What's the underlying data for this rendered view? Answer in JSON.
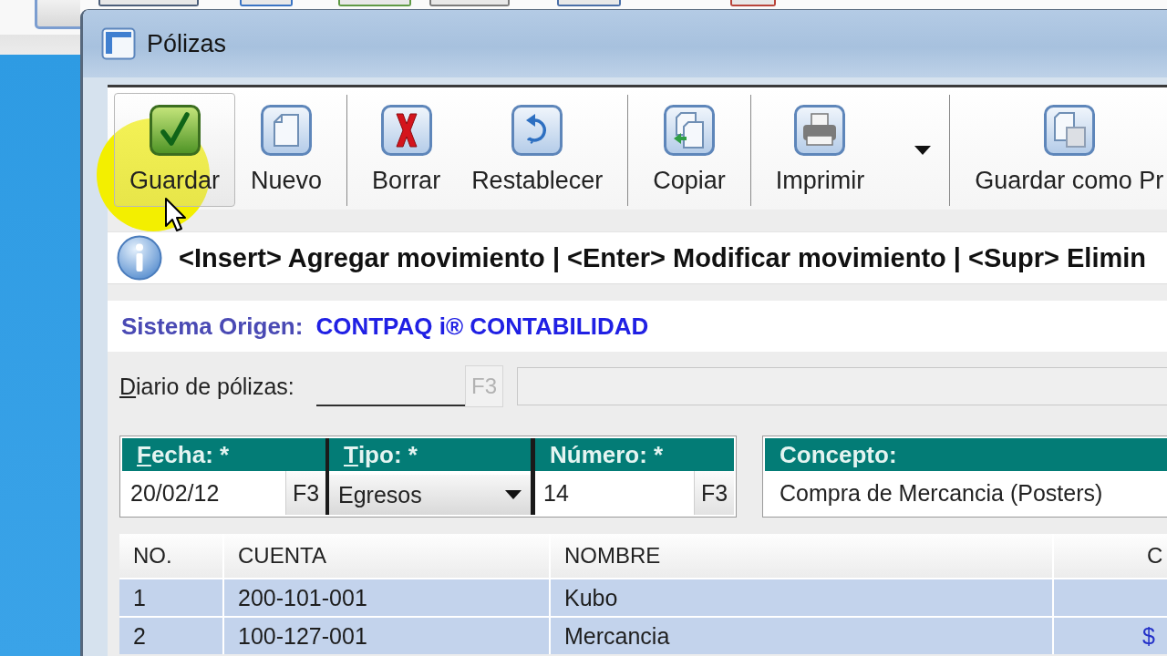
{
  "window": {
    "title": "Pólizas"
  },
  "pointer": {
    "highlight": true
  },
  "toolbar": {
    "groups": [
      {
        "buttons": [
          {
            "label": "Guardar",
            "kind": "save",
            "hovered": true,
            "dropdown": false
          },
          {
            "label": "Nuevo",
            "kind": "new",
            "hovered": false,
            "dropdown": false
          }
        ]
      },
      {
        "buttons": [
          {
            "label": "Borrar",
            "kind": "delete",
            "hovered": false,
            "dropdown": false
          },
          {
            "label": "Restablecer",
            "kind": "restore",
            "hovered": false,
            "dropdown": false
          }
        ]
      },
      {
        "buttons": [
          {
            "label": "Copiar",
            "kind": "copy",
            "hovered": false,
            "dropdown": false
          }
        ]
      },
      {
        "buttons": [
          {
            "label": "Imprimir",
            "kind": "print",
            "hovered": false,
            "dropdown": true
          }
        ]
      },
      {
        "buttons": [
          {
            "label": "Guardar como Pr",
            "kind": "save-template",
            "hovered": false,
            "dropdown": false
          }
        ]
      }
    ]
  },
  "info_bar": {
    "text": "<Insert> Agregar movimiento | <Enter> Modificar movimiento | <Supr> Elimin"
  },
  "origin": {
    "label": "Sistema Origen:",
    "value": "CONTPAQ i® CONTABILIDAD"
  },
  "journal": {
    "label": "Diario de pólizas:",
    "access_key": true,
    "lookup_button": {
      "label": "F3",
      "disabled": true
    }
  },
  "header": {
    "fields": [
      {
        "label": "Fecha: *",
        "access_key": true,
        "kind": "lookup",
        "value": "20/02/12",
        "button": "F3"
      },
      {
        "label": "Tipo: *",
        "access_key": true,
        "kind": "dropdown",
        "value": "Egresos"
      },
      {
        "label": "Número: *",
        "access_key": false,
        "kind": "lookup",
        "value": "14",
        "button": "F3"
      }
    ]
  },
  "concept": {
    "label": "Concepto:",
    "value": "Compra de Mercancia (Posters)"
  },
  "table": {
    "columns": [
      "NO.",
      "CUENTA",
      "NOMBRE",
      "C"
    ],
    "rows": [
      {
        "cells": [
          "1",
          "200-101-001",
          "Kubo"
        ]
      },
      {
        "cells": [
          "2",
          "100-127-001",
          "Mercancia",
          "$"
        ]
      }
    ]
  }
}
